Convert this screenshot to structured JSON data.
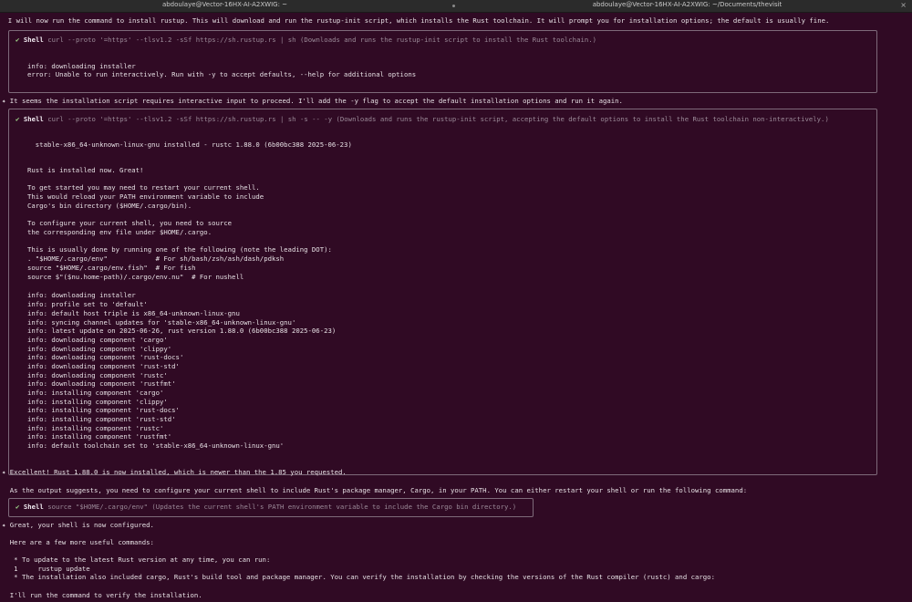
{
  "window": {
    "left_title": "abdoulaye@Vector-16HX-AI-A2XWIG: ~",
    "right_title": "abdoulaye@Vector-16HX-AI-A2XWIG: ~/Documents/thevisit"
  },
  "intro_line": "  I will now run the command to install rustup. This will download and run the rustup-init script, which installs the Rust toolchain. It will prompt you for installation options; the default is usually fine.",
  "shell1": {
    "check": "✔",
    "label": "Shell",
    "command": "curl --proto '=https' --tlsv1.2 -sSf https://sh.rustup.rs | sh (Downloads and runs the rustup-init script to install the Rust toolchain.)",
    "output": [
      "info: downloading installer",
      "error: Unable to run interactively. Run with -y to accept defaults, --help for additional options"
    ]
  },
  "note1": "✦ It seems the installation script requires interactive input to proceed. I'll add the -y flag to accept the default installation options and run it again.",
  "shell2": {
    "check": "✔",
    "label": "Shell",
    "command": "curl --proto '=https' --tlsv1.2 -sSf https://sh.rustup.rs | sh -s -- -y (Downloads and runs the rustup-init script, accepting the default options to install the Rust toolchain non-interactively.)",
    "installed_line": "  stable-x86_64-unknown-linux-gnu installed - rustc 1.88.0 (6b00bc388 2025-06-23)",
    "output": [
      "Rust is installed now. Great!",
      "",
      "To get started you may need to restart your current shell.",
      "This would reload your PATH environment variable to include",
      "Cargo's bin directory ($HOME/.cargo/bin).",
      "",
      "To configure your current shell, you need to source",
      "the corresponding env file under $HOME/.cargo.",
      "",
      "This is usually done by running one of the following (note the leading DOT):",
      ". \"$HOME/.cargo/env\"            # For sh/bash/zsh/ash/dash/pdksh",
      "source \"$HOME/.cargo/env.fish\"  # For fish",
      "source $\"($nu.home-path)/.cargo/env.nu\"  # For nushell",
      "",
      "info: downloading installer",
      "info: profile set to 'default'",
      "info: default host triple is x86_64-unknown-linux-gnu",
      "info: syncing channel updates for 'stable-x86_64-unknown-linux-gnu'",
      "info: latest update on 2025-06-26, rust version 1.88.0 (6b00bc388 2025-06-23)",
      "info: downloading component 'cargo'",
      "info: downloading component 'clippy'",
      "info: downloading component 'rust-docs'",
      "info: downloading component 'rust-std'",
      "info: downloading component 'rustc'",
      "info: downloading component 'rustfmt'",
      "info: installing component 'cargo'",
      "info: installing component 'clippy'",
      "info: installing component 'rust-docs'",
      "info: installing component 'rust-std'",
      "info: installing component 'rustc'",
      "info: installing component 'rustfmt'",
      "info: default toolchain set to 'stable-x86_64-unknown-linux-gnu'"
    ]
  },
  "note2": "✦ Excellent! Rust 1.88.0 is now installed, which is newer than the 1.85 you requested.",
  "note2_detail": "  As the output suggests, you need to configure your current shell to include Rust's package manager, Cargo, in your PATH. You can either restart your shell or run the following command:",
  "shell3": {
    "check": "✔",
    "label": "Shell",
    "command": "source \"$HOME/.cargo/env\" (Updates the current shell's PATH environment variable to include the Cargo bin directory.)"
  },
  "note3": "✦ Great, your shell is now configured.",
  "more_commands": "  Here are a few more useful commands:",
  "bullets": [
    "   * To update to the latest Rust version at any time, you can run:",
    "   1     rustup update",
    "   * The installation also included cargo, Rust's build tool and package manager. You can verify the installation by checking the versions of the Rust compiler (rustc) and cargo:"
  ],
  "final_line": "  I'll run the command to verify the installation."
}
